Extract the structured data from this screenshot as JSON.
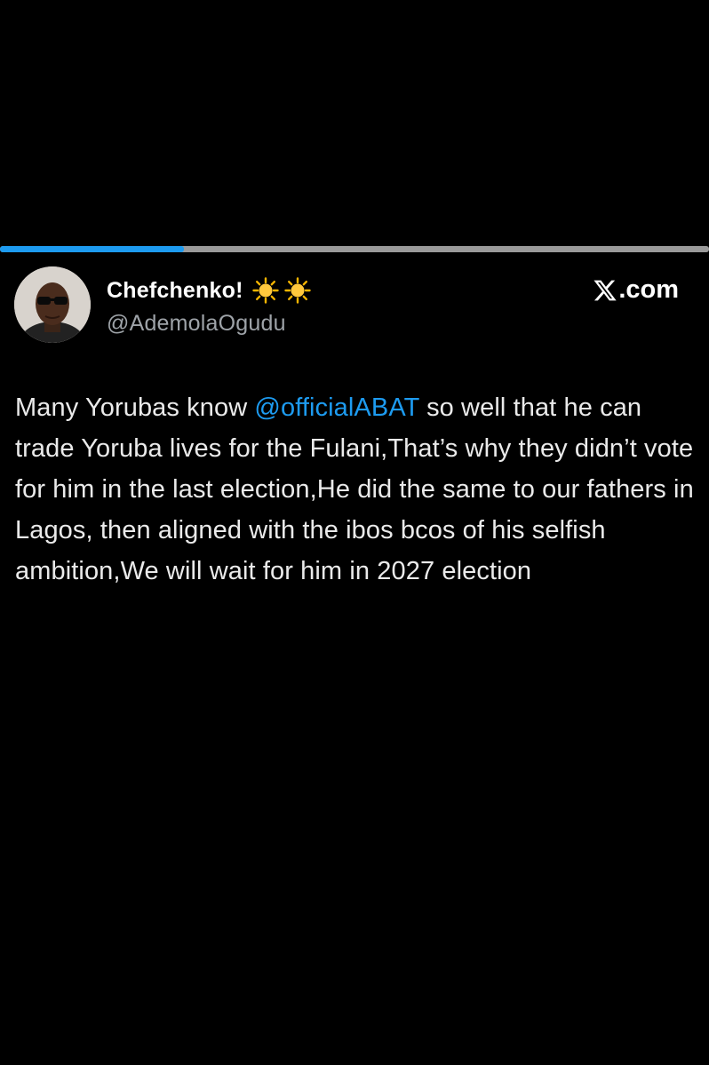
{
  "story": {
    "progress": 0.26,
    "track_color": "#9a9a9a",
    "fill_color": "#1d9bf0"
  },
  "author": {
    "display_name": "Chefchenko!",
    "badges": [
      "sun-emoji",
      "sun-emoji"
    ],
    "handle": "@AdemolaOgudu"
  },
  "brand": {
    "label": ".com",
    "icon": "x-logo-icon"
  },
  "tweet": {
    "text_before": "Many Yorubas know ",
    "mention": "@officialABAT",
    "text_after": " so well that he can trade Yoruba lives for the Fulani,That’s why they didn’t vote for him in the last election,He did the same to our fathers in Lagos, then aligned with the ibos bcos of his selfish ambition,We will wait for him in 2027 election",
    "mention_color": "#1d9bf0"
  }
}
